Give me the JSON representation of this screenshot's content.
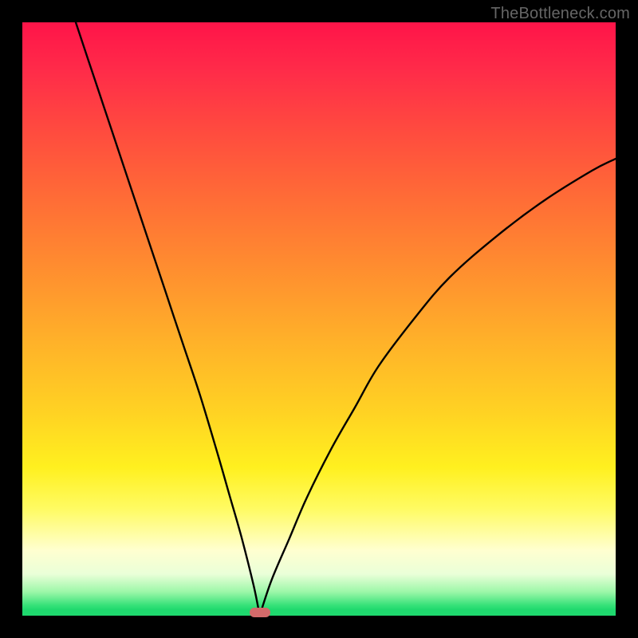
{
  "watermark": "TheBottleneck.com",
  "colors": {
    "frame": "#000000",
    "gradient_top": "#ff1449",
    "gradient_mid": "#ffd323",
    "gradient_bottom": "#1fd96e",
    "curve": "#000000",
    "marker": "#d36a6a"
  },
  "chart_data": {
    "type": "line",
    "title": "",
    "xlabel": "",
    "ylabel": "",
    "xlim": [
      0,
      100
    ],
    "ylim": [
      0,
      100
    ],
    "grid": false,
    "legend": false,
    "description": "V-shaped bottleneck curve with minimum near x≈40, overlaid on a red-to-green vertical gradient; x-axis roughly represents component balance and y-axis the bottleneck severity (%).",
    "minimum": {
      "x": 40,
      "y": 0
    },
    "series": [
      {
        "name": "left-branch",
        "x": [
          9,
          12,
          15,
          18,
          21,
          24,
          27,
          30,
          33,
          35,
          37,
          39,
          40
        ],
        "y": [
          100,
          91,
          82,
          73,
          64,
          55,
          46,
          37,
          27,
          20,
          13,
          5,
          0
        ]
      },
      {
        "name": "right-branch",
        "x": [
          40,
          42,
          45,
          48,
          52,
          56,
          60,
          66,
          72,
          80,
          88,
          96,
          100
        ],
        "y": [
          0,
          6,
          13,
          20,
          28,
          35,
          42,
          50,
          57,
          64,
          70,
          75,
          77
        ]
      }
    ],
    "marker": {
      "x": 40,
      "y": 0.5,
      "shape": "rounded-bar"
    }
  }
}
